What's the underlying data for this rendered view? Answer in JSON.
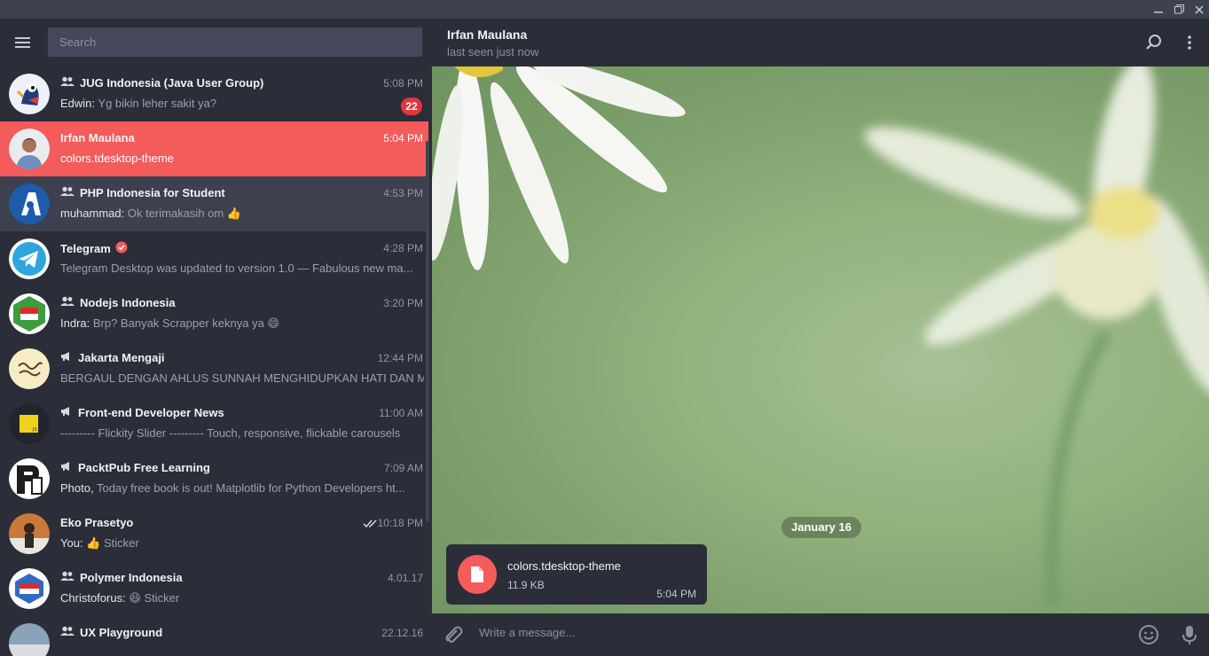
{
  "search": {
    "placeholder": "Search"
  },
  "chats": [
    {
      "name": "JUG Indonesia (Java User Group)",
      "type": "group",
      "time": "5:08 PM",
      "sender": "Edwin:",
      "preview": " Yg bikin leher sakit ya?",
      "badge": "22"
    },
    {
      "name": "Irfan Maulana",
      "type": "user",
      "time": "5:04 PM",
      "sender": "",
      "preview": "colors.tdesktop-theme",
      "active": true
    },
    {
      "name": "PHP Indonesia for Student",
      "type": "group",
      "time": "4:53 PM",
      "sender": "muhammad:",
      "preview": " Ok terimakasih om 👍"
    },
    {
      "name": "Telegram",
      "type": "verified",
      "time": "4:28 PM",
      "sender": "",
      "preview": "Telegram Desktop was updated to version 1.0  — Fabulous new ma..."
    },
    {
      "name": "Nodejs Indonesia",
      "type": "group",
      "time": "3:20 PM",
      "sender": "Indra:",
      "preview": " Brp? Banyak Scrapper keknya ya 😄"
    },
    {
      "name": "Jakarta Mengaji",
      "type": "channel",
      "time": "12:44 PM",
      "sender": "",
      "preview": "BERGAUL DENGAN AHLUS SUNNAH MENGHIDUPKAN HATI DAN M..."
    },
    {
      "name": "Front-end Developer News",
      "type": "channel",
      "time": "11:00 AM",
      "sender": "",
      "preview": "--------- Flickity Slider ---------  Touch, responsive, flickable carousels"
    },
    {
      "name": "PacktPub Free Learning",
      "type": "channel",
      "time": "7:09 AM",
      "sender": "Photo,",
      "preview": " Today free book is out! Matplotlib for Python Developers ht..."
    },
    {
      "name": "Eko Prasetyo",
      "type": "user",
      "time": "10:18 PM",
      "sender": "You:",
      "preview": " 👍 Sticker",
      "read": true
    },
    {
      "name": "Polymer Indonesia",
      "type": "group",
      "time": "4.01.17",
      "sender": "Christoforus:",
      "preview": " 😆 Sticker"
    },
    {
      "name": "UX Playground",
      "type": "group",
      "time": "22.12.16",
      "sender": "",
      "preview": ""
    }
  ],
  "peer": {
    "name": "Irfan Maulana",
    "status": "last seen just now"
  },
  "date_label": "January 16",
  "message": {
    "file_name": "colors.tdesktop-theme",
    "file_size": "11.9 KB",
    "time": "5:04 PM"
  },
  "composer": {
    "placeholder": "Write a message..."
  },
  "colors": {
    "accent": "#f45b5b",
    "panel": "#2b2e39",
    "badge": "#e0363e"
  }
}
